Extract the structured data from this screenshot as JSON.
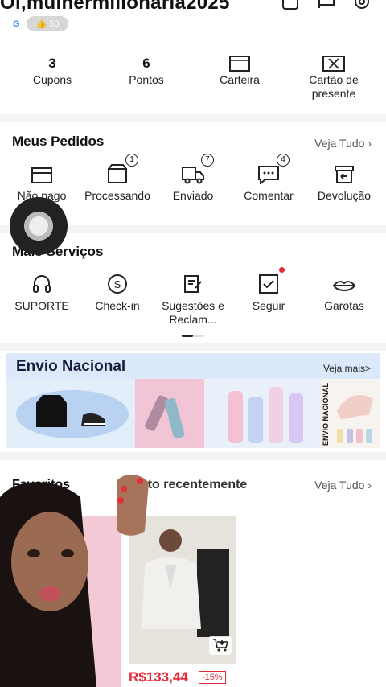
{
  "header": {
    "greeting": "Oi,mulhermilionaria2025",
    "level": "50"
  },
  "stats": [
    {
      "value": "3",
      "label": "Cupons"
    },
    {
      "value": "6",
      "label": "Pontos"
    },
    {
      "value": "",
      "label": "Carteira"
    },
    {
      "value": "",
      "label": "Cartão de presente"
    }
  ],
  "orders": {
    "title": "Meus Pedidos",
    "see_all": "Veja Tudo",
    "items": [
      {
        "label": "Não pago",
        "icon": "wallet-icon",
        "badge": ""
      },
      {
        "label": "Processando",
        "icon": "box-icon",
        "badge": "1"
      },
      {
        "label": "Enviado",
        "icon": "truck-icon",
        "badge": "7"
      },
      {
        "label": "Comentar",
        "icon": "comment-icon",
        "badge": "4"
      },
      {
        "label": "Devolução",
        "icon": "return-icon",
        "badge": ""
      }
    ]
  },
  "services": {
    "title": "Mais Serviços",
    "items": [
      {
        "label": "SUPORTE",
        "icon": "headset-icon"
      },
      {
        "label": "Check-in",
        "icon": "coin-icon"
      },
      {
        "label": "Sugestões e Reclam...",
        "icon": "feedback-icon"
      },
      {
        "label": "Seguir",
        "icon": "follow-icon"
      },
      {
        "label": "Garotas",
        "icon": "lips-icon"
      }
    ]
  },
  "banner": {
    "title": "Envio Nacional",
    "more": "Veja mais>",
    "side_text": "ENVIO NACIONAL"
  },
  "favorites": {
    "tab_favorites": "Favoritos",
    "tab_recent": "Visto recentemente",
    "see_all": "Veja Tudo",
    "product_price": "R$133,44",
    "product_discount": "-15%"
  },
  "colors": {
    "accent": "#e52a3a",
    "banner_bg": "#dbe9fa",
    "separator": "#f4f4f4"
  }
}
